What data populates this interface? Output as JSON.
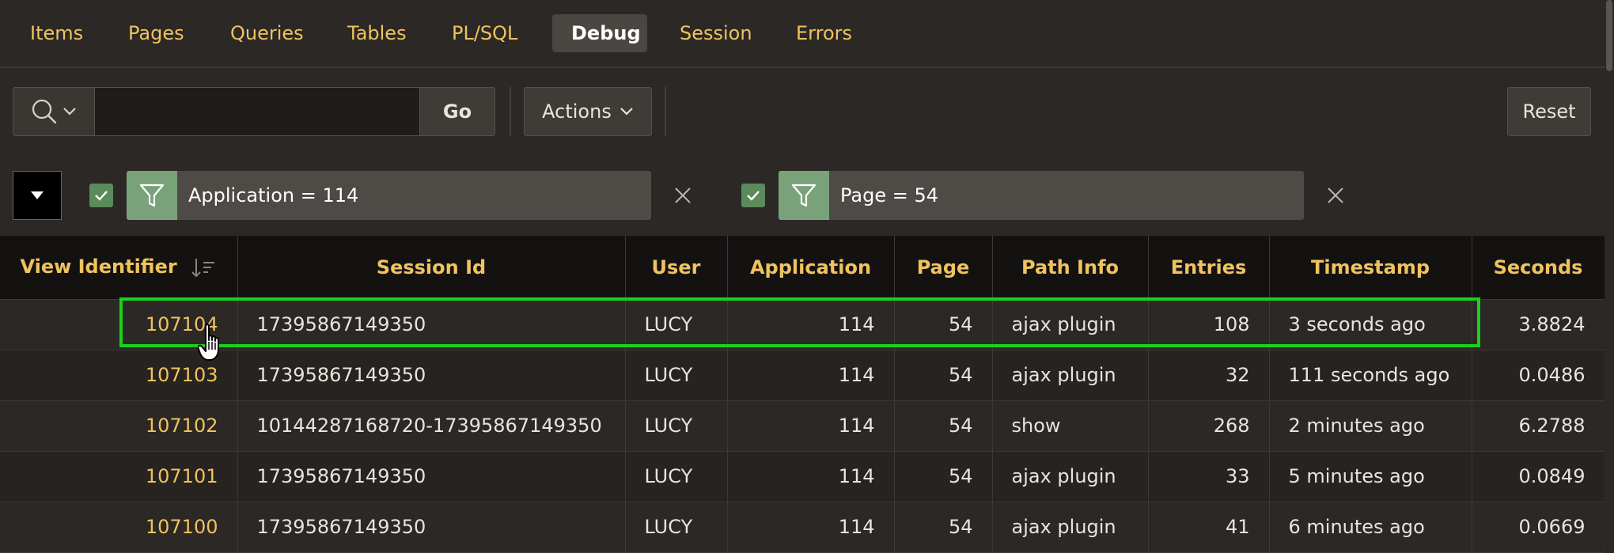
{
  "tabs": [
    {
      "label": "Items",
      "active": false
    },
    {
      "label": "Pages",
      "active": false
    },
    {
      "label": "Queries",
      "active": false
    },
    {
      "label": "Tables",
      "active": false
    },
    {
      "label": "PL/SQL",
      "active": false
    },
    {
      "label": "Debug",
      "active": true
    },
    {
      "label": "Session",
      "active": false
    },
    {
      "label": "Errors",
      "active": false
    }
  ],
  "toolbar": {
    "search_value": "",
    "go_label": "Go",
    "actions_label": "Actions",
    "reset_label": "Reset"
  },
  "filters": [
    {
      "label": "Application = 114",
      "enabled": true
    },
    {
      "label": "Page = 54",
      "enabled": true
    }
  ],
  "table": {
    "columns": [
      "View Identifier",
      "Session Id",
      "User",
      "Application",
      "Page",
      "Path Info",
      "Entries",
      "Timestamp",
      "Seconds"
    ],
    "rows": [
      {
        "view_id": "107104",
        "session_id": "17395867149350",
        "user": "LUCY",
        "application": "114",
        "page": "54",
        "path_info": "ajax plugin",
        "entries": "108",
        "timestamp": "3 seconds ago",
        "seconds": "3.8824"
      },
      {
        "view_id": "107103",
        "session_id": "17395867149350",
        "user": "LUCY",
        "application": "114",
        "page": "54",
        "path_info": "ajax plugin",
        "entries": "32",
        "timestamp": "111 seconds ago",
        "seconds": "0.0486"
      },
      {
        "view_id": "107102",
        "session_id": "10144287168720-17395867149350",
        "user": "LUCY",
        "application": "114",
        "page": "54",
        "path_info": "show",
        "entries": "268",
        "timestamp": "2 minutes ago",
        "seconds": "6.2788"
      },
      {
        "view_id": "107101",
        "session_id": "17395867149350",
        "user": "LUCY",
        "application": "114",
        "page": "54",
        "path_info": "ajax plugin",
        "entries": "33",
        "timestamp": "5 minutes ago",
        "seconds": "0.0849"
      },
      {
        "view_id": "107100",
        "session_id": "17395867149350",
        "user": "LUCY",
        "application": "114",
        "page": "54",
        "path_info": "ajax plugin",
        "entries": "41",
        "timestamp": "6 minutes ago",
        "seconds": "0.0669"
      }
    ]
  },
  "colors": {
    "accent": "#f0c35f",
    "highlight": "#1bd11b",
    "filter_icon_bg": "#7aa27a",
    "checkbox": "#5b8a5b"
  },
  "icons": {
    "search": "search-icon",
    "chevron": "chevron-down-icon",
    "filter": "filter-icon",
    "close": "close-icon",
    "sort": "sort-descending-icon",
    "check": "check-icon",
    "collapse": "triangle-down-icon",
    "cursor": "hand-pointer-icon"
  }
}
